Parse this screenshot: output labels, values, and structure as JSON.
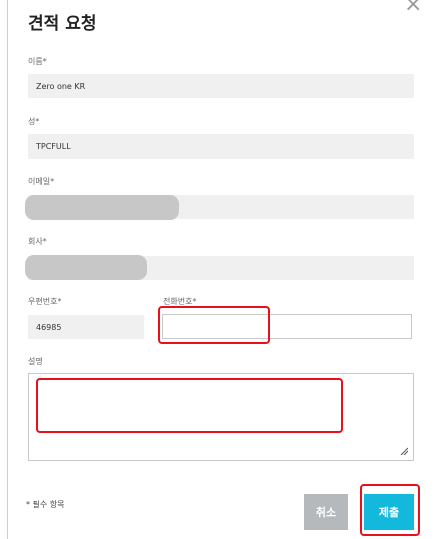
{
  "dialog": {
    "title": "견적 요청",
    "close_glyph": "×"
  },
  "fields": {
    "first_name": {
      "label": "이름*",
      "value": "Zero one KR"
    },
    "last_name": {
      "label": "성*",
      "value": "TPCFULL"
    },
    "email": {
      "label": "이메일*",
      "value": ""
    },
    "company": {
      "label": "회사*",
      "value": ""
    },
    "postal_code": {
      "label": "우편번호*",
      "value": "46985"
    },
    "phone": {
      "label": "전화번호*",
      "value": ""
    },
    "description": {
      "label": "설명",
      "value": ""
    }
  },
  "footer": {
    "required_note": "* 필수 항목",
    "cancel_label": "취소",
    "submit_label": "제출"
  },
  "colors": {
    "field_bg": "#f0f0f0",
    "cancel_bg": "#b5b9bb",
    "submit_bg": "#12b9dd",
    "annotation": "#e8101c"
  },
  "icons": {
    "close": "close-icon",
    "resize": "resize-grip-icon"
  }
}
